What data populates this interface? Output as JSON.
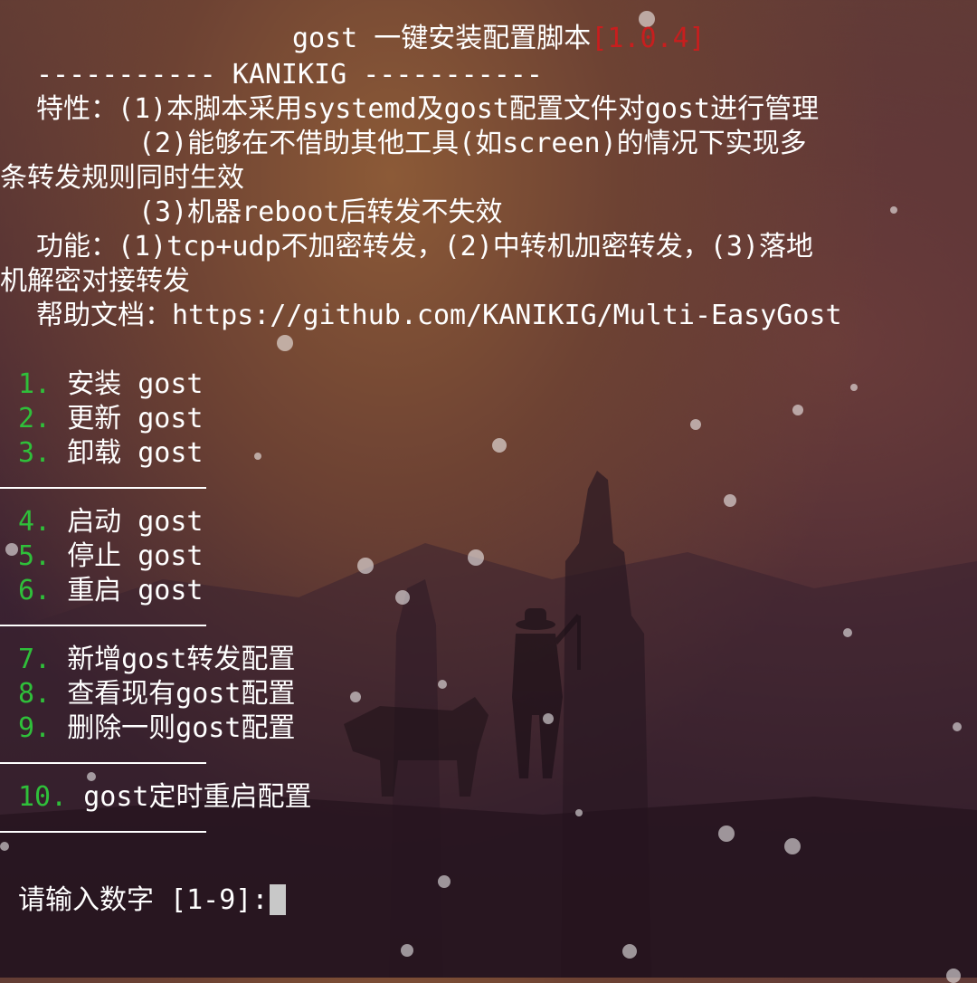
{
  "header": {
    "title": "gost 一键安装配置脚本",
    "version": "[1.0.4]",
    "separator": "----------- KANIKIG -----------"
  },
  "features": {
    "label": "特性：",
    "item1": "(1)本脚本采用systemd及gost配置文件对gost进行管理",
    "item2_a": "(2)能够在不借助其他工具(如screen)的情况下实现多",
    "item2_b": "条转发规则同时生效",
    "item3": "(3)机器reboot后转发不失效"
  },
  "functions": {
    "label": "功能：",
    "text_a": "(1)tcp+udp不加密转发，(2)中转机加密转发，(3)落地",
    "text_b": "机解密对接转发"
  },
  "help": {
    "label": "帮助文档：",
    "url": "https://github.com/KANIKIG/Multi-EasyGost"
  },
  "menu": [
    {
      "num": "1.",
      "label": "安装 gost"
    },
    {
      "num": "2.",
      "label": "更新 gost"
    },
    {
      "num": "3.",
      "label": "卸载 gost"
    },
    {
      "num": "4.",
      "label": "启动 gost"
    },
    {
      "num": "5.",
      "label": "停止 gost"
    },
    {
      "num": "6.",
      "label": "重启 gost"
    },
    {
      "num": "7.",
      "label": "新增gost转发配置"
    },
    {
      "num": "8.",
      "label": "查看现有gost配置"
    },
    {
      "num": "9.",
      "label": "删除一则gost配置"
    },
    {
      "num": "10.",
      "label": "gost定时重启配置"
    }
  ],
  "prompt": {
    "text": "请输入数字 [1-9]:"
  },
  "colors": {
    "version": "#c81e1e",
    "menu_number": "#2fbf3a",
    "text": "#ffffff"
  }
}
